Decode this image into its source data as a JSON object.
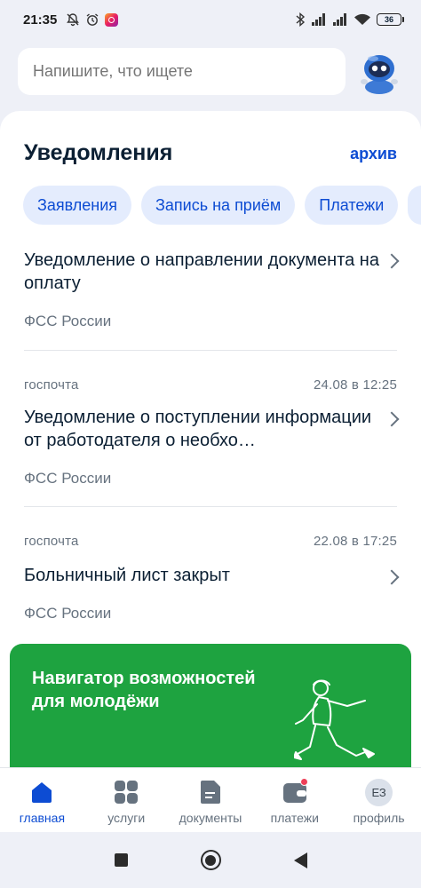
{
  "status_bar": {
    "time": "21:35",
    "battery": "36"
  },
  "search": {
    "placeholder": "Напишите, что ищете"
  },
  "notifications": {
    "title": "Уведомления",
    "archive_label": "архив",
    "filters": [
      "Заявления",
      "Запись на приём",
      "Платежи"
    ],
    "items": [
      {
        "source": "",
        "date": "",
        "title": "Уведомление о направлении документа на оплату",
        "org": "ФСС России"
      },
      {
        "source": "госпочта",
        "date": "24.08 в 12:25",
        "title": "Уведомление о поступлении информации от работодателя о необхо…",
        "org": "ФСС России"
      },
      {
        "source": "госпочта",
        "date": "22.08 в 17:25",
        "title": "Больничный лист закрыт",
        "org": "ФСС России"
      }
    ]
  },
  "promo": {
    "title": "Навигатор возможностей для молодёжи"
  },
  "bottom_nav": [
    {
      "label": "главная",
      "icon": "home-icon",
      "active": true
    },
    {
      "label": "услуги",
      "icon": "grid-icon"
    },
    {
      "label": "документы",
      "icon": "document-icon"
    },
    {
      "label": "платежи",
      "icon": "wallet-icon",
      "badge": true
    },
    {
      "label": "профиль",
      "icon": "avatar",
      "initials": "ЕЗ"
    }
  ],
  "colors": {
    "accent": "#0d4cd3",
    "promo_bg": "#1ea340",
    "badge": "#ee3f58",
    "text_secondary": "#66727f"
  }
}
